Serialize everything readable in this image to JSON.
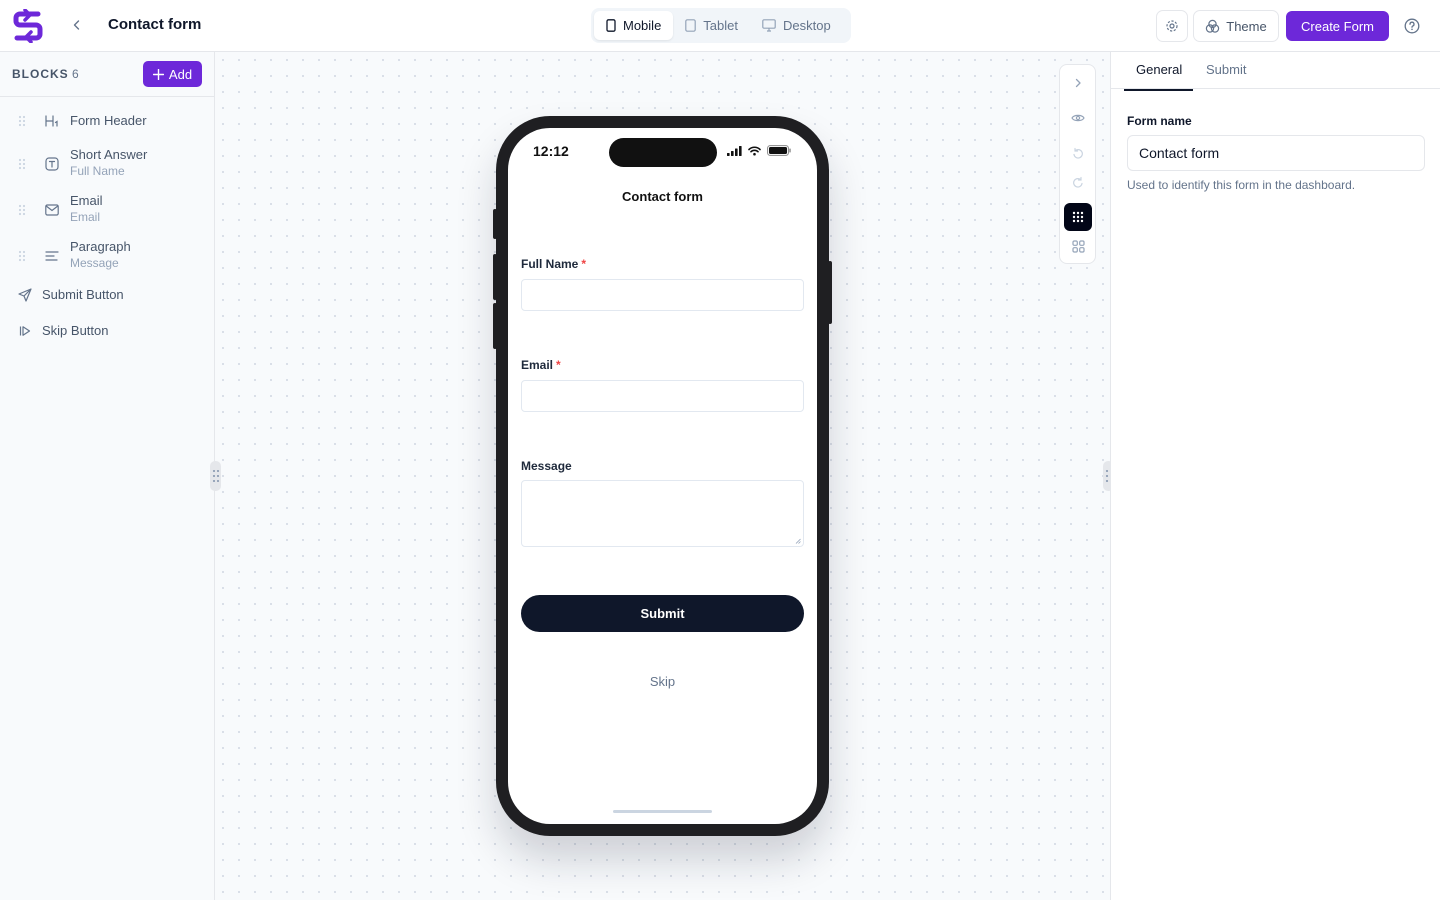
{
  "header": {
    "title": "Contact form",
    "device_tabs": [
      {
        "label": "Mobile",
        "icon": "smartphone-icon",
        "active": true
      },
      {
        "label": "Tablet",
        "icon": "tablet-icon",
        "active": false
      },
      {
        "label": "Desktop",
        "icon": "monitor-icon",
        "active": false
      }
    ],
    "theme_label": "Theme",
    "create_label": "Create Form"
  },
  "sidebar": {
    "title": "BLOCKS",
    "count": "6",
    "add_label": "Add",
    "blocks": [
      {
        "label": "Form Header",
        "sub": "",
        "icon": "heading-icon"
      },
      {
        "label": "Short Answer",
        "sub": "Full Name",
        "icon": "text-field-icon"
      },
      {
        "label": "Email",
        "sub": "Email",
        "icon": "mail-icon"
      },
      {
        "label": "Paragraph",
        "sub": "Message",
        "icon": "paragraph-icon"
      }
    ],
    "buttons": [
      {
        "label": "Submit Button",
        "icon": "send-icon"
      },
      {
        "label": "Skip Button",
        "icon": "skip-forward-icon"
      }
    ]
  },
  "phone": {
    "time": "12:12",
    "form": {
      "title": "Contact form",
      "fields": [
        {
          "label": "Full Name",
          "required": "*"
        },
        {
          "label": "Email",
          "required": "*"
        },
        {
          "label": "Message",
          "required": ""
        }
      ],
      "submit_label": "Submit",
      "skip_label": "Skip"
    }
  },
  "panel": {
    "tabs": [
      {
        "label": "General",
        "active": true
      },
      {
        "label": "Submit",
        "active": false
      }
    ],
    "form_name_label": "Form name",
    "form_name_value": "Contact form",
    "form_name_help": "Used to identify this form in the dashboard."
  },
  "colors": {
    "accent": "#6d28d9",
    "dark": "#0f172a",
    "required": "#ef4444"
  }
}
